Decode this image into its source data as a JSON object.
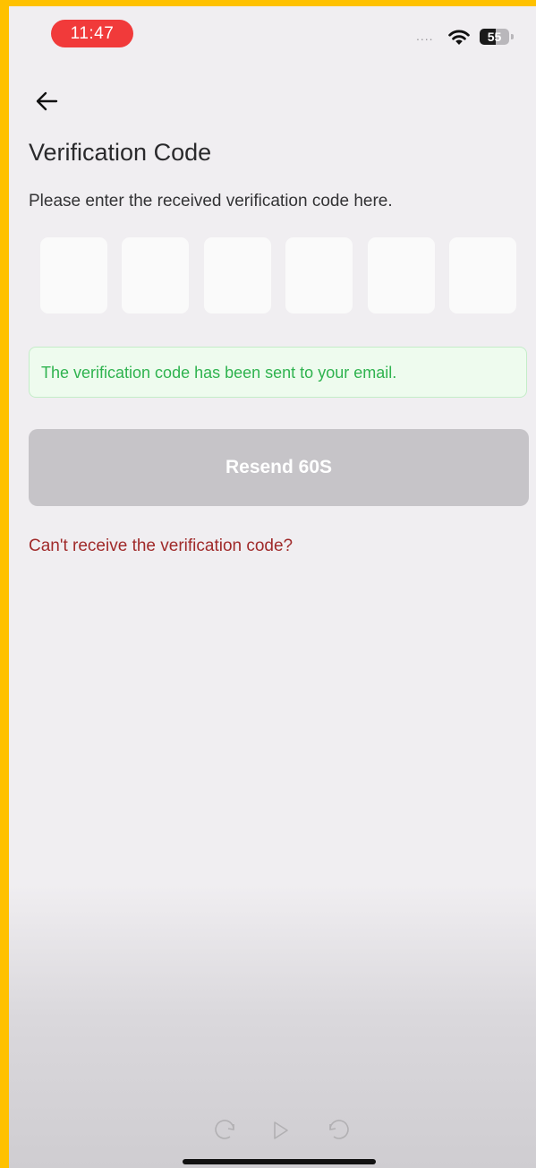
{
  "status_bar": {
    "time": "11:47",
    "signal": "....",
    "battery_level": "55"
  },
  "header": {
    "back_icon": "arrow-left-icon",
    "title": "Verification Code",
    "subtitle": "Please enter the received verification code here."
  },
  "code_inputs": {
    "count": 6,
    "values": [
      "",
      "",
      "",
      "",
      "",
      ""
    ]
  },
  "notice": {
    "text": "The verification code has been sent to your email.",
    "color": "#2fb34f"
  },
  "resend_button": {
    "label": "Resend 60S",
    "state": "disabled"
  },
  "help_link": {
    "text": "Can't receive the verification code?",
    "color": "#a02a2a"
  },
  "media_controls": {
    "icons": [
      "rewind-10-icon",
      "play-icon",
      "forward-10-icon"
    ]
  }
}
